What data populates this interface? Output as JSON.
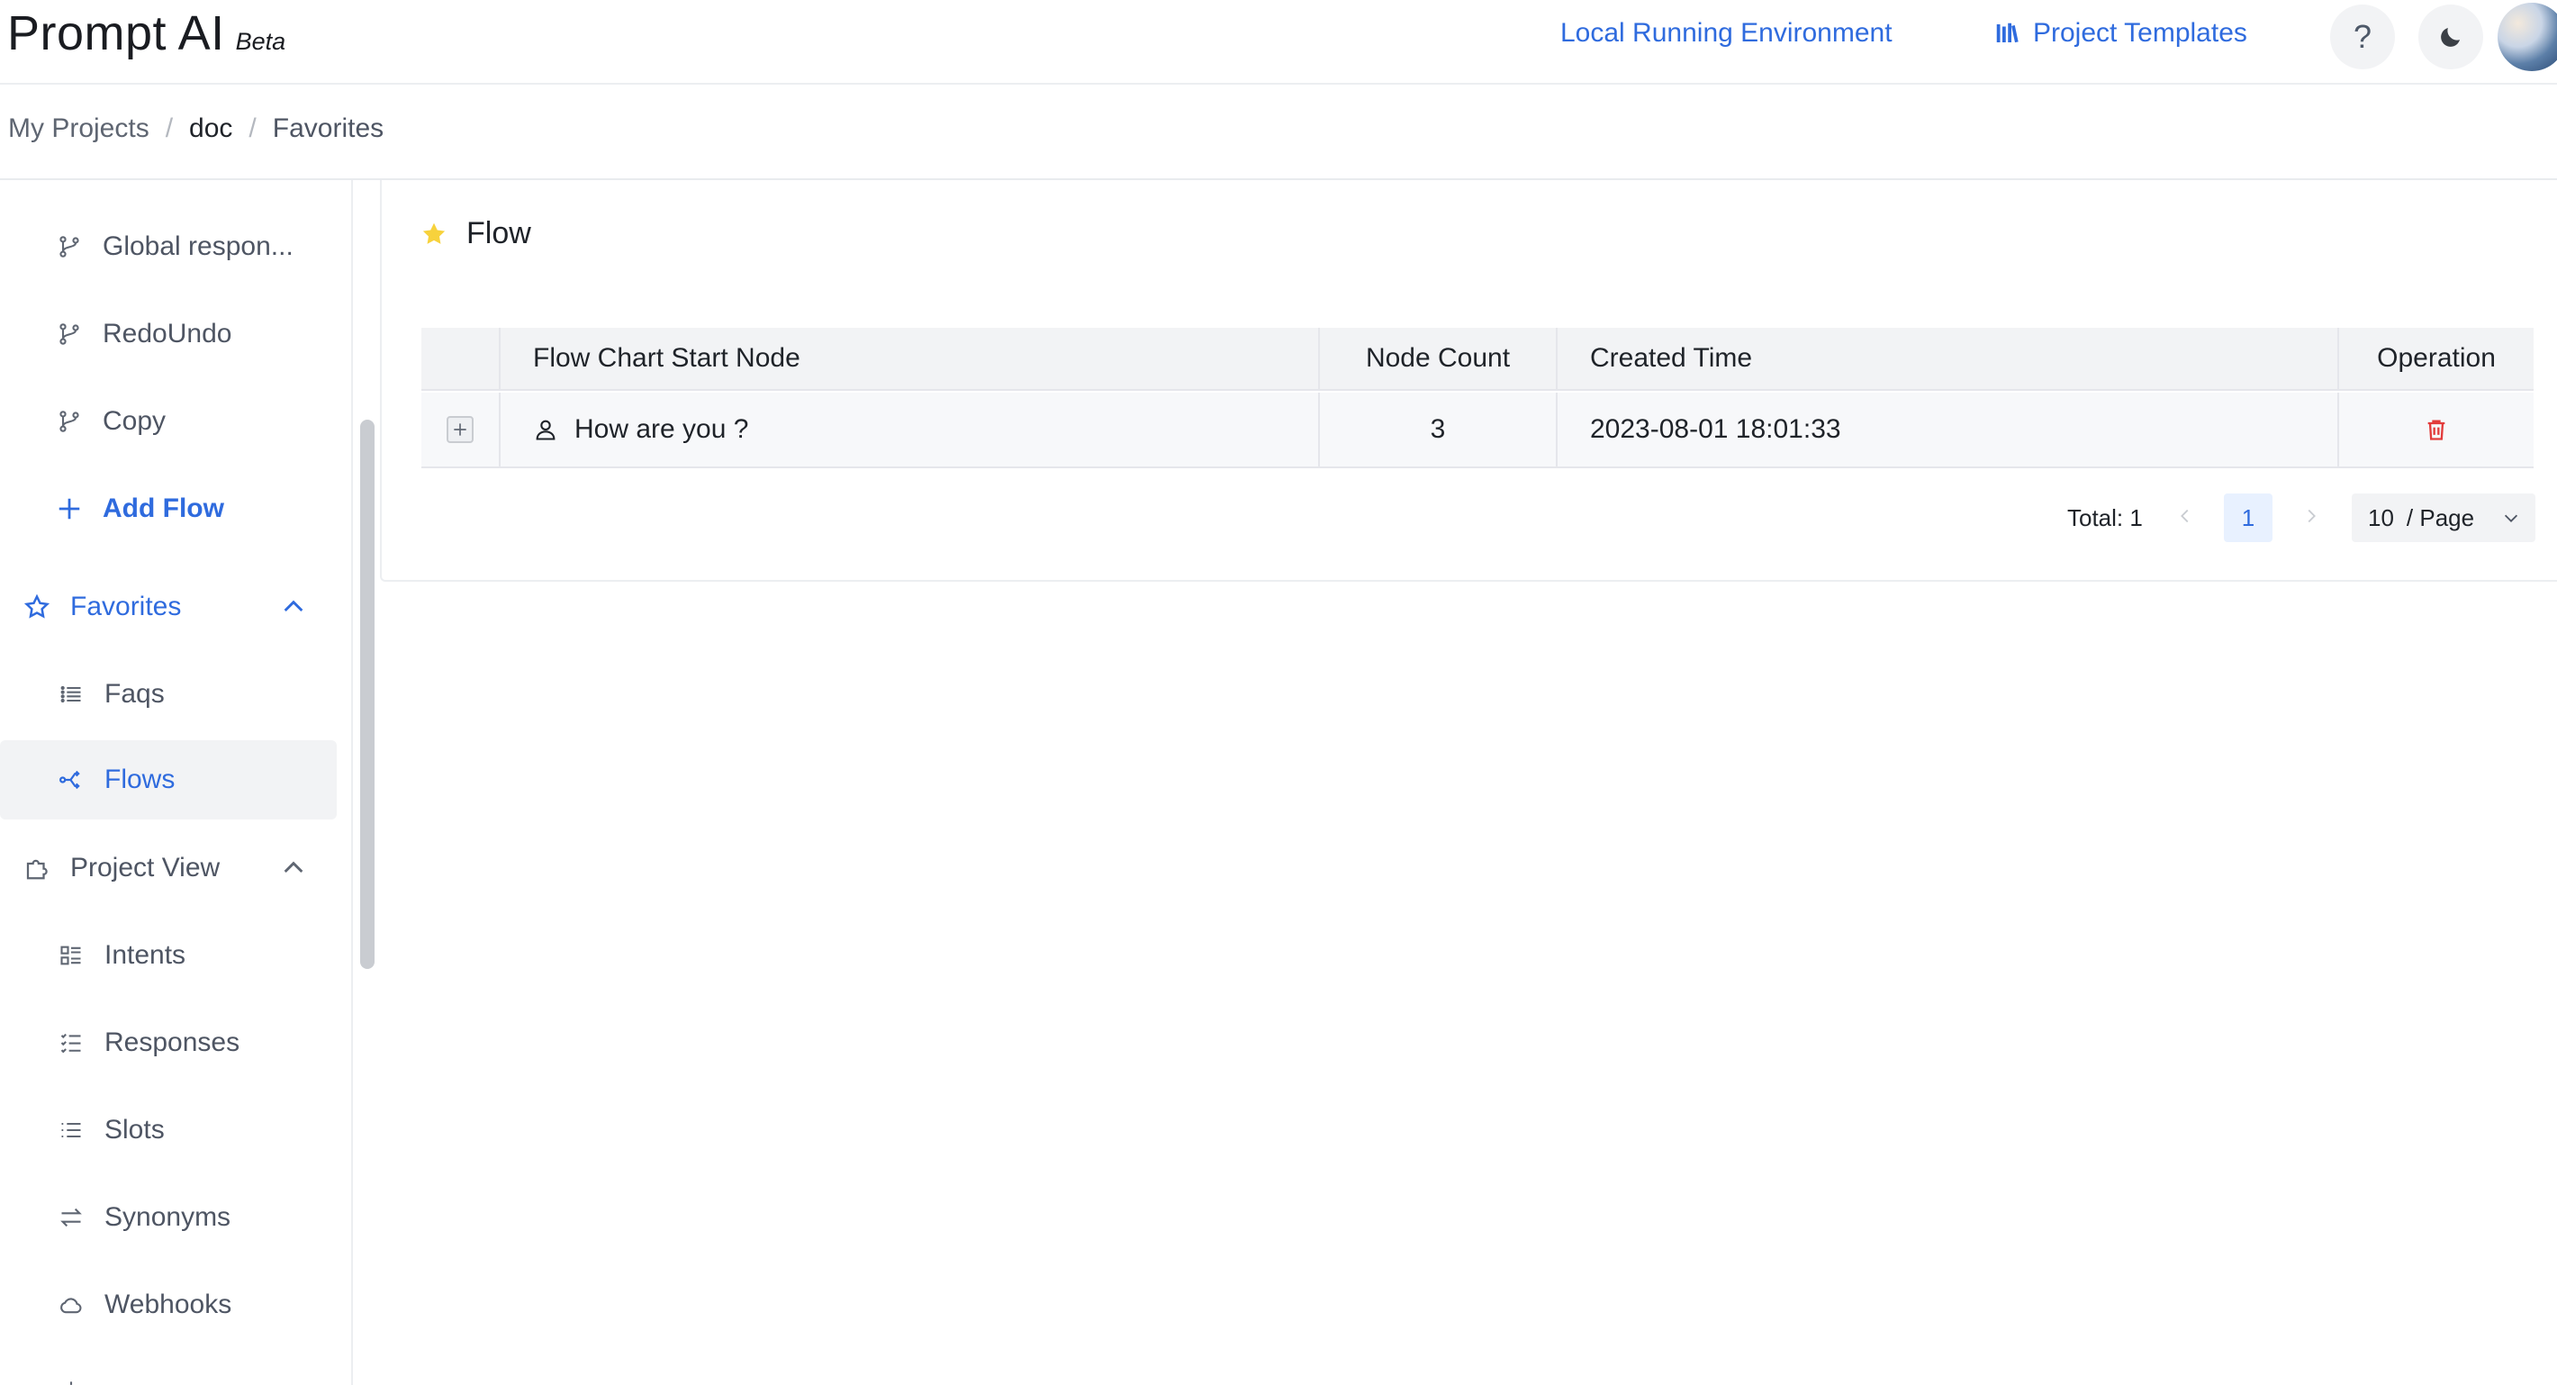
{
  "header": {
    "brand": "Prompt AI",
    "badge": "Beta",
    "env_link": "Local Running Environment",
    "templates_link": "Project Templates",
    "help_label": "?"
  },
  "breadcrumb": {
    "items": [
      "My Projects",
      "doc",
      "Favorites"
    ],
    "separator": "/"
  },
  "sidebar": {
    "flows": [
      {
        "label": "Global respon...",
        "icon": "branch-icon"
      },
      {
        "label": "RedoUndo",
        "icon": "branch-icon"
      },
      {
        "label": "Copy",
        "icon": "branch-icon"
      }
    ],
    "add_flow": "Add Flow",
    "favorites": {
      "label": "Favorites",
      "items": [
        {
          "label": "Faqs",
          "icon": "list-icon"
        },
        {
          "label": "Flows",
          "icon": "flow-icon",
          "active": true
        }
      ]
    },
    "project_view": {
      "label": "Project View",
      "items": [
        {
          "label": "Intents",
          "icon": "intents-icon"
        },
        {
          "label": "Responses",
          "icon": "responses-icon"
        },
        {
          "label": "Slots",
          "icon": "slots-icon"
        },
        {
          "label": "Synonyms",
          "icon": "synonyms-icon"
        },
        {
          "label": "Webhooks",
          "icon": "cloud-icon"
        }
      ]
    }
  },
  "main": {
    "title": "Flow",
    "table": {
      "columns": [
        "Flow Chart Start Node",
        "Node Count",
        "Created Time",
        "Operation"
      ],
      "rows": [
        {
          "start_node": "How are you ?",
          "node_count": "3",
          "created_time": "2023-08-01 18:01:33"
        }
      ]
    },
    "pagination": {
      "total": "Total: 1",
      "current_page": "1",
      "page_size": "10",
      "page_size_unit": "/ Page"
    }
  },
  "colors": {
    "accent": "#2f6bde",
    "star": "#f7d23c",
    "delete": "#e23b3b"
  }
}
